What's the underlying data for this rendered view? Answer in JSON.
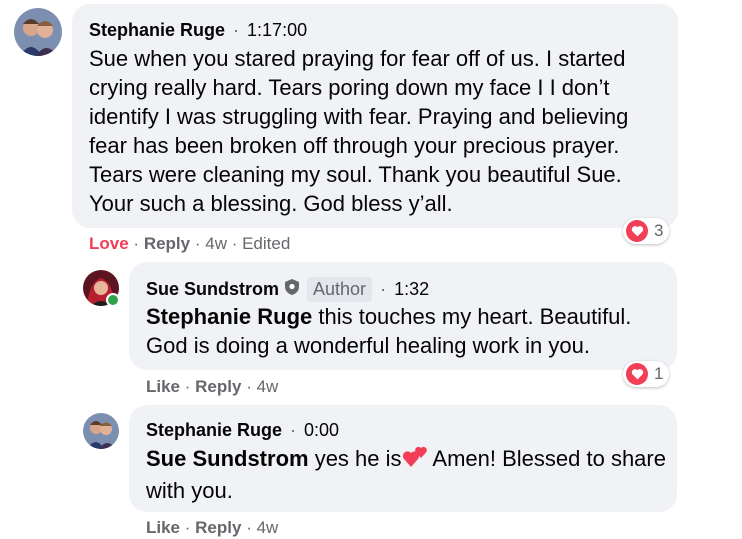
{
  "comments": [
    {
      "author": "Stephanie Ruge",
      "time": "1:17:00",
      "text": "Sue when you stared praying for fear off of us. I started crying really hard. Tears poring down my face I I don’t identify I was struggling with fear. Praying and believing fear has been broken off through your precious prayer. Tears were cleaning my soul. Thank you beautiful Sue. Your such a blessing. God bless y’all.",
      "action1": "Love",
      "action2": "Reply",
      "age": "4w",
      "edited": "Edited",
      "reaction_count": "3"
    },
    {
      "author": "Sue Sundstrom",
      "badge": "Author",
      "time": "1:32",
      "mention": "Stephanie Ruge",
      "text": " this touches my heart. Beautiful. God is doing a wonderful healing work in you.",
      "action1": "Like",
      "action2": "Reply",
      "age": "4w",
      "reaction_count": "1"
    },
    {
      "author": "Stephanie Ruge",
      "time": "0:00",
      "mention": "Sue Sundstrom",
      "text_before_emoji": " yes he is",
      "text_after_emoji": " Amen! Blessed to share with you.",
      "action1": "Like",
      "action2": "Reply",
      "age": "4w"
    }
  ],
  "separator": "·",
  "colors": {
    "love": "#f33e58",
    "bubble": "#f0f2f5",
    "meta": "#65676b",
    "online": "#31a24c"
  },
  "icons": {
    "reaction": "heart-icon",
    "author_badge": "shield-icon",
    "emoji": "two-hearts-icon"
  }
}
